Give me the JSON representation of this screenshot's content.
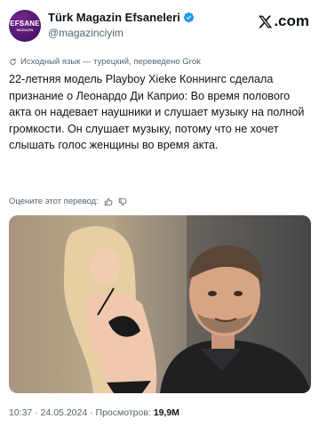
{
  "account": {
    "display_name": "Türk Magazin Efsaneleri",
    "handle": "@magazinciyim",
    "avatar_text": "EFSANE",
    "avatar_subtext": "MAGAZIN",
    "verified_icon": "verified-badge-icon",
    "verified_color": "#1d9bf0",
    "brand_color": "#5a1a78"
  },
  "site_logo": {
    "icon": "x-logo-icon",
    "text": ".com"
  },
  "translation_note": "Исходный язык — турецкий, переведено Grok",
  "tweet_text": "22-летняя модель Playboy Xieke Коннингс сделала признание о Леонардо Ди Каприо: Во время полового акта он надевает наушники и слушает музыку на полной громкости. Он слушает музыку, потому что не хочет слышать голос женщины во время акта.",
  "rate_translation": {
    "label": "Оцените этот перевод:",
    "icons": [
      "thumbs-up-icon",
      "thumbs-down-icon"
    ]
  },
  "media": {
    "type": "photo collage",
    "description_icons": [
      "woman-photo",
      "man-photo"
    ]
  },
  "meta": {
    "time": "10:37",
    "separator": "·",
    "date": "24.05.2024",
    "views_label": "Просмотров:",
    "views": "19,9M"
  }
}
